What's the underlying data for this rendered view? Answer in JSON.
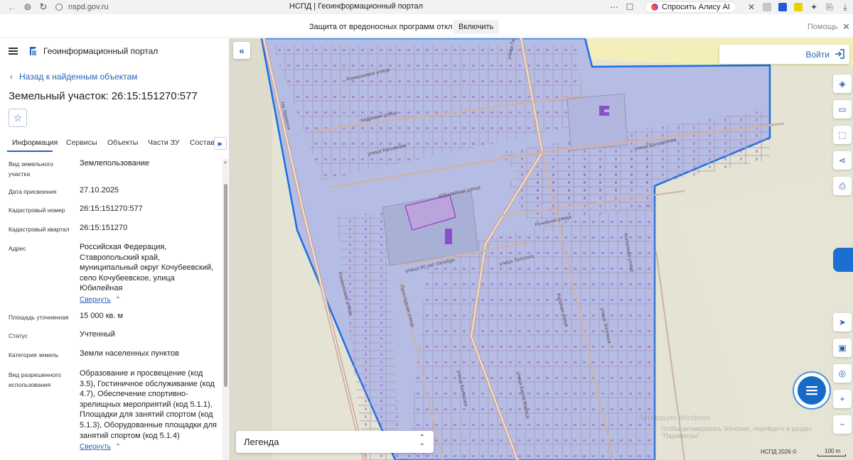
{
  "browser": {
    "url": "nspd.gov.ru",
    "tab_title": "НСПД | Геоинформационный портал",
    "alice_label": "Спросить Алису AI",
    "protection_text": "Защита от вредоносных программ отключена",
    "protection_button": "Включить",
    "protection_help": "Помощь"
  },
  "panel": {
    "portal_title": "Геоинформационный портал",
    "back_link": "Назад к найденным объектам",
    "title": "Земельный участок: 26:15:151270:577",
    "tabs": [
      "Информация",
      "Сервисы",
      "Объекты",
      "Части ЗУ",
      "Состав"
    ],
    "fields": [
      {
        "label": "Вид земельного участка",
        "value": "Землепользование"
      },
      {
        "label": "Дата присвоения",
        "value": "27.10.2025"
      },
      {
        "label": "Кадастровый номер",
        "value": "26:15:151270:577"
      },
      {
        "label": "Кадастровый квартал",
        "value": "26:15:151270"
      },
      {
        "label": "Адрес",
        "value": "Российская Федерация, Ставропольский край, муниципальный округ Кочубеевский, село Кочубеевское, улица Юбилейная"
      },
      {
        "label": "Площадь уточненная",
        "value": "15 000 кв. м"
      },
      {
        "label": "Статус",
        "value": "Учтенный"
      },
      {
        "label": "Категория земель",
        "value": "Земли населенных пунктов"
      },
      {
        "label": "Вид разрешенного использования",
        "value": "Образование и просвещение (код 3.5), Гостиничное обслуживание (код 4.7), Обеспечение спортивно-зрелищных мероприятий (код 5.1.1), Площадки для занятий спортом (код 5.1.3), Оборудованные площадки для занятий спортом (код 5.1.4)"
      }
    ],
    "collapse_label": "Свернуть"
  },
  "map": {
    "login_label": "Войти",
    "legend_label": "Легенда",
    "watermark_line1": "Активация Windows",
    "watermark_line2": "Чтобы активировать Windows, перейдите в раздел \"Параметры\".",
    "copyright": "НСПД 2026 ©",
    "scale": "100 m",
    "streets": [
      "Ромашковая улица",
      "Кедровая улица",
      "улица Касьянова",
      "Юбилейная улица",
      "улица Гагарина",
      "улица Балахонова",
      "Ручейная улица",
      "улица 60 лет Октября",
      "улица Толстого",
      "Прохладная улица",
      "Рабочая улица",
      "улица Энгельса",
      "улица Карла Маркса",
      "Колхозная улица",
      "улица Белякова",
      "На Черкесск"
    ],
    "colors": {
      "zone_fill": "#b6bde4",
      "zone_border": "#1a6fe0",
      "parcel_highlight": "#b25fce",
      "field_fill": "#e4e3d4",
      "yellow_field": "#f3eeba"
    }
  }
}
